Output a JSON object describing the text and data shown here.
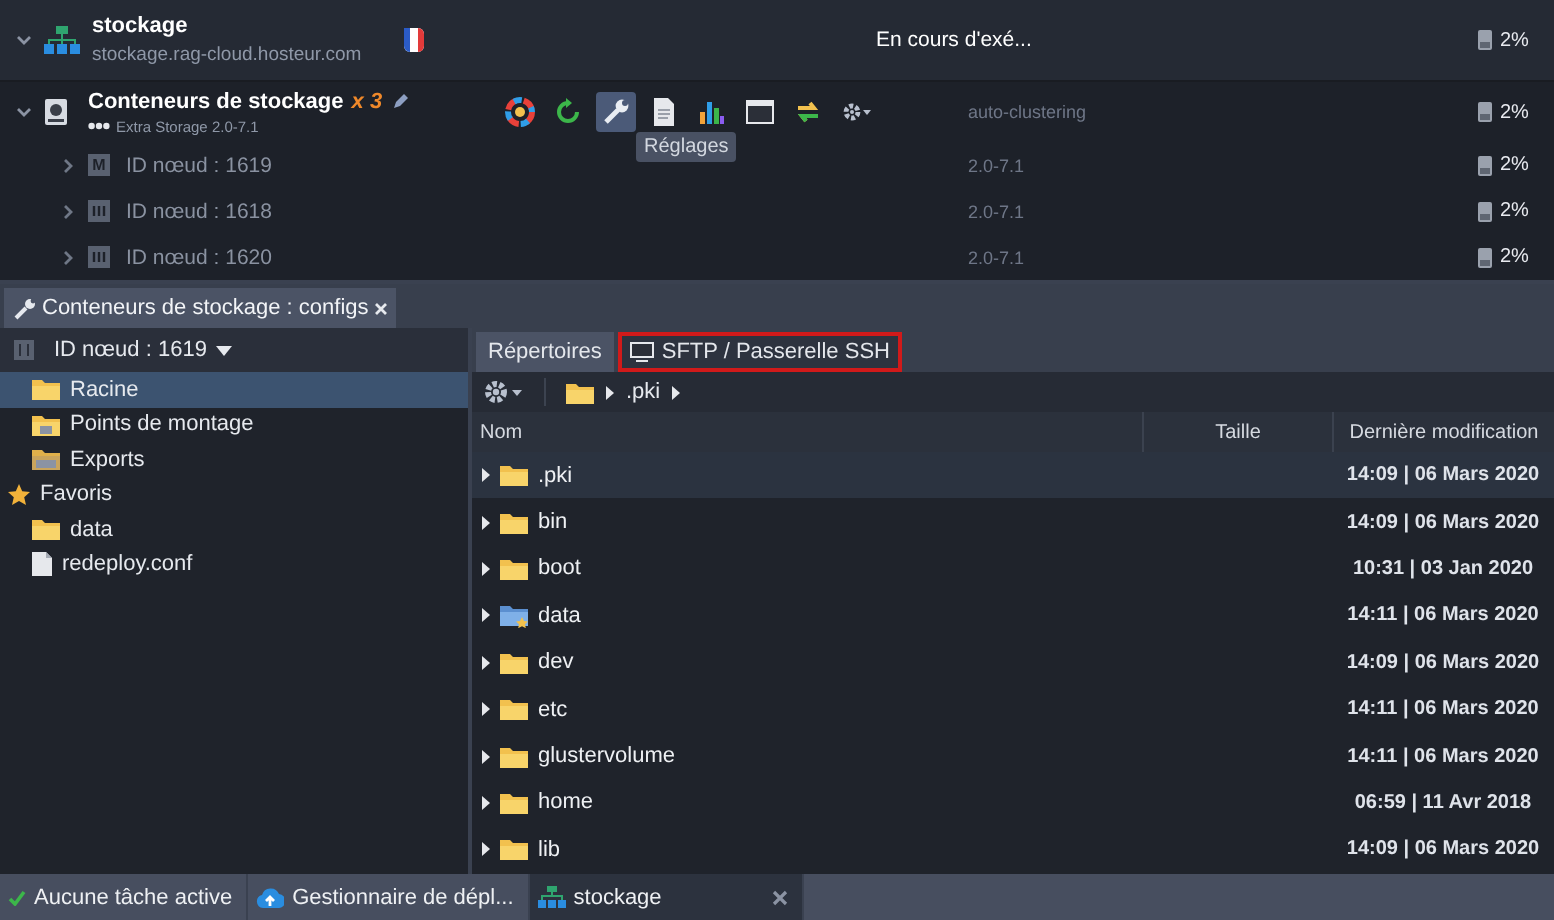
{
  "environment": {
    "name": "stockage",
    "domain": "stockage.rag-cloud.hosteur.com",
    "status": "En cours d'exé...",
    "disk": "2%",
    "expanded": true
  },
  "group": {
    "name": "Conteneurs de stockage",
    "count": "x 3",
    "subtitle": "Extra Storage 2.0-7.1",
    "tag": "auto-clustering",
    "disk": "2%",
    "expanded": true,
    "tooltip": "Réglages",
    "tools": [
      {
        "kind": "colors",
        "selected": false
      },
      {
        "kind": "restart",
        "selected": false
      },
      {
        "kind": "settings",
        "selected": true
      },
      {
        "kind": "log",
        "selected": false
      },
      {
        "kind": "stats",
        "selected": false
      },
      {
        "kind": "terminal",
        "selected": false
      },
      {
        "kind": "redeploy",
        "selected": false
      },
      {
        "kind": "more",
        "selected": false
      }
    ]
  },
  "nodes": [
    {
      "badge": "M",
      "label": "ID nœud : 1619",
      "version": "2.0-7.1",
      "disk": "2%"
    },
    {
      "label": "ID nœud : 1618",
      "version": "2.0-7.1",
      "disk": "2%"
    },
    {
      "label": "ID nœud : 1620",
      "version": "2.0-7.1",
      "disk": "2%"
    }
  ],
  "panel_tab": {
    "title": "Conteneurs de stockage : configs"
  },
  "sidebar": {
    "node_selector": "ID nœud : 1619",
    "items": [
      {
        "label": "Racine",
        "kind": "folder",
        "selected": true
      },
      {
        "label": "Points de montage",
        "kind": "mount",
        "selected": false
      },
      {
        "label": "Exports",
        "kind": "export",
        "selected": false
      }
    ],
    "favorites": {
      "label": "Favoris",
      "items": [
        {
          "label": "data",
          "kind": "folder",
          "selected": false
        },
        {
          "label": "redeploy.conf",
          "kind": "file",
          "selected": false
        }
      ]
    }
  },
  "tabs": [
    {
      "label": "Répertoires",
      "selected": true,
      "highlighted": false
    },
    {
      "label": "SFTP / Passerelle SSH",
      "selected": false,
      "highlighted": true
    }
  ],
  "breadcrumb": [
    ".pki"
  ],
  "table": {
    "columns": [
      "Nom",
      "Taille",
      "Dernière modification"
    ],
    "rows": [
      {
        "name": ".pki",
        "kind": "folder",
        "modified": "14:09 | 06 Mars 2020",
        "selected": true
      },
      {
        "name": "bin",
        "kind": "folder",
        "modified": "14:09 | 06 Mars 2020",
        "selected": false
      },
      {
        "name": "boot",
        "kind": "folder",
        "modified": "10:31 | 03 Jan 2020",
        "selected": false
      },
      {
        "name": "data",
        "kind": "favorite",
        "modified": "14:11 | 06 Mars 2020",
        "selected": false
      },
      {
        "name": "dev",
        "kind": "folder",
        "modified": "14:09 | 06 Mars 2020",
        "selected": false
      },
      {
        "name": "etc",
        "kind": "folder",
        "modified": "14:11 | 06 Mars 2020",
        "selected": false
      },
      {
        "name": "glustervolume",
        "kind": "folder",
        "modified": "14:11 | 06 Mars 2020",
        "selected": false
      },
      {
        "name": "home",
        "kind": "folder",
        "modified": "06:59 | 11 Avr 2018",
        "selected": false
      },
      {
        "name": "lib",
        "kind": "folder",
        "modified": "14:09 | 06 Mars 2020",
        "selected": false
      }
    ]
  },
  "taskbar": [
    {
      "label": "Aucune tâche active",
      "kind": "status",
      "selected": false
    },
    {
      "label": "Gestionnaire de dépl...",
      "kind": "deploy",
      "selected": false
    },
    {
      "label": "stockage",
      "kind": "env",
      "selected": true
    }
  ]
}
